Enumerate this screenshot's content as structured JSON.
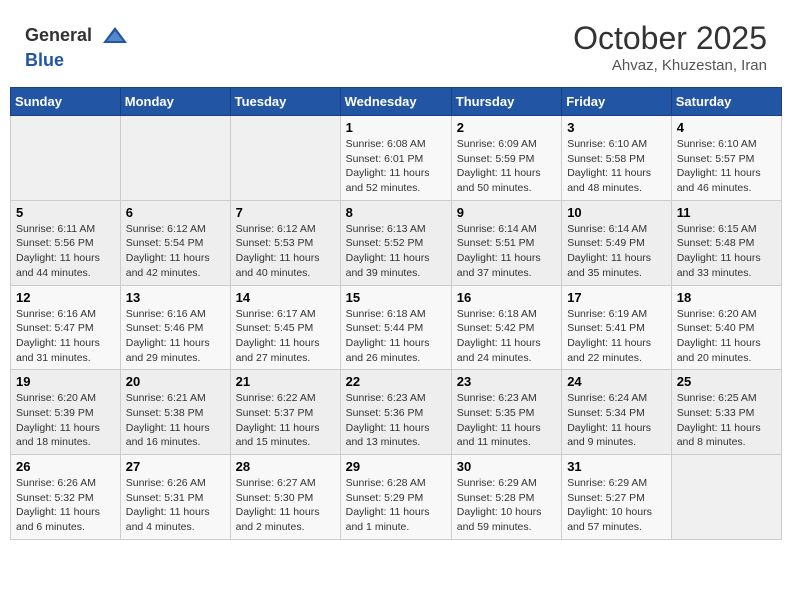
{
  "header": {
    "logo_general": "General",
    "logo_blue": "Blue",
    "month_title": "October 2025",
    "subtitle": "Ahvaz, Khuzestan, Iran"
  },
  "days_of_week": [
    "Sunday",
    "Monday",
    "Tuesday",
    "Wednesday",
    "Thursday",
    "Friday",
    "Saturday"
  ],
  "weeks": [
    [
      {
        "day": "",
        "sunrise": "",
        "sunset": "",
        "daylight": ""
      },
      {
        "day": "",
        "sunrise": "",
        "sunset": "",
        "daylight": ""
      },
      {
        "day": "",
        "sunrise": "",
        "sunset": "",
        "daylight": ""
      },
      {
        "day": "1",
        "sunrise": "Sunrise: 6:08 AM",
        "sunset": "Sunset: 6:01 PM",
        "daylight": "Daylight: 11 hours and 52 minutes."
      },
      {
        "day": "2",
        "sunrise": "Sunrise: 6:09 AM",
        "sunset": "Sunset: 5:59 PM",
        "daylight": "Daylight: 11 hours and 50 minutes."
      },
      {
        "day": "3",
        "sunrise": "Sunrise: 6:10 AM",
        "sunset": "Sunset: 5:58 PM",
        "daylight": "Daylight: 11 hours and 48 minutes."
      },
      {
        "day": "4",
        "sunrise": "Sunrise: 6:10 AM",
        "sunset": "Sunset: 5:57 PM",
        "daylight": "Daylight: 11 hours and 46 minutes."
      }
    ],
    [
      {
        "day": "5",
        "sunrise": "Sunrise: 6:11 AM",
        "sunset": "Sunset: 5:56 PM",
        "daylight": "Daylight: 11 hours and 44 minutes."
      },
      {
        "day": "6",
        "sunrise": "Sunrise: 6:12 AM",
        "sunset": "Sunset: 5:54 PM",
        "daylight": "Daylight: 11 hours and 42 minutes."
      },
      {
        "day": "7",
        "sunrise": "Sunrise: 6:12 AM",
        "sunset": "Sunset: 5:53 PM",
        "daylight": "Daylight: 11 hours and 40 minutes."
      },
      {
        "day": "8",
        "sunrise": "Sunrise: 6:13 AM",
        "sunset": "Sunset: 5:52 PM",
        "daylight": "Daylight: 11 hours and 39 minutes."
      },
      {
        "day": "9",
        "sunrise": "Sunrise: 6:14 AM",
        "sunset": "Sunset: 5:51 PM",
        "daylight": "Daylight: 11 hours and 37 minutes."
      },
      {
        "day": "10",
        "sunrise": "Sunrise: 6:14 AM",
        "sunset": "Sunset: 5:49 PM",
        "daylight": "Daylight: 11 hours and 35 minutes."
      },
      {
        "day": "11",
        "sunrise": "Sunrise: 6:15 AM",
        "sunset": "Sunset: 5:48 PM",
        "daylight": "Daylight: 11 hours and 33 minutes."
      }
    ],
    [
      {
        "day": "12",
        "sunrise": "Sunrise: 6:16 AM",
        "sunset": "Sunset: 5:47 PM",
        "daylight": "Daylight: 11 hours and 31 minutes."
      },
      {
        "day": "13",
        "sunrise": "Sunrise: 6:16 AM",
        "sunset": "Sunset: 5:46 PM",
        "daylight": "Daylight: 11 hours and 29 minutes."
      },
      {
        "day": "14",
        "sunrise": "Sunrise: 6:17 AM",
        "sunset": "Sunset: 5:45 PM",
        "daylight": "Daylight: 11 hours and 27 minutes."
      },
      {
        "day": "15",
        "sunrise": "Sunrise: 6:18 AM",
        "sunset": "Sunset: 5:44 PM",
        "daylight": "Daylight: 11 hours and 26 minutes."
      },
      {
        "day": "16",
        "sunrise": "Sunrise: 6:18 AM",
        "sunset": "Sunset: 5:42 PM",
        "daylight": "Daylight: 11 hours and 24 minutes."
      },
      {
        "day": "17",
        "sunrise": "Sunrise: 6:19 AM",
        "sunset": "Sunset: 5:41 PM",
        "daylight": "Daylight: 11 hours and 22 minutes."
      },
      {
        "day": "18",
        "sunrise": "Sunrise: 6:20 AM",
        "sunset": "Sunset: 5:40 PM",
        "daylight": "Daylight: 11 hours and 20 minutes."
      }
    ],
    [
      {
        "day": "19",
        "sunrise": "Sunrise: 6:20 AM",
        "sunset": "Sunset: 5:39 PM",
        "daylight": "Daylight: 11 hours and 18 minutes."
      },
      {
        "day": "20",
        "sunrise": "Sunrise: 6:21 AM",
        "sunset": "Sunset: 5:38 PM",
        "daylight": "Daylight: 11 hours and 16 minutes."
      },
      {
        "day": "21",
        "sunrise": "Sunrise: 6:22 AM",
        "sunset": "Sunset: 5:37 PM",
        "daylight": "Daylight: 11 hours and 15 minutes."
      },
      {
        "day": "22",
        "sunrise": "Sunrise: 6:23 AM",
        "sunset": "Sunset: 5:36 PM",
        "daylight": "Daylight: 11 hours and 13 minutes."
      },
      {
        "day": "23",
        "sunrise": "Sunrise: 6:23 AM",
        "sunset": "Sunset: 5:35 PM",
        "daylight": "Daylight: 11 hours and 11 minutes."
      },
      {
        "day": "24",
        "sunrise": "Sunrise: 6:24 AM",
        "sunset": "Sunset: 5:34 PM",
        "daylight": "Daylight: 11 hours and 9 minutes."
      },
      {
        "day": "25",
        "sunrise": "Sunrise: 6:25 AM",
        "sunset": "Sunset: 5:33 PM",
        "daylight": "Daylight: 11 hours and 8 minutes."
      }
    ],
    [
      {
        "day": "26",
        "sunrise": "Sunrise: 6:26 AM",
        "sunset": "Sunset: 5:32 PM",
        "daylight": "Daylight: 11 hours and 6 minutes."
      },
      {
        "day": "27",
        "sunrise": "Sunrise: 6:26 AM",
        "sunset": "Sunset: 5:31 PM",
        "daylight": "Daylight: 11 hours and 4 minutes."
      },
      {
        "day": "28",
        "sunrise": "Sunrise: 6:27 AM",
        "sunset": "Sunset: 5:30 PM",
        "daylight": "Daylight: 11 hours and 2 minutes."
      },
      {
        "day": "29",
        "sunrise": "Sunrise: 6:28 AM",
        "sunset": "Sunset: 5:29 PM",
        "daylight": "Daylight: 11 hours and 1 minute."
      },
      {
        "day": "30",
        "sunrise": "Sunrise: 6:29 AM",
        "sunset": "Sunset: 5:28 PM",
        "daylight": "Daylight: 10 hours and 59 minutes."
      },
      {
        "day": "31",
        "sunrise": "Sunrise: 6:29 AM",
        "sunset": "Sunset: 5:27 PM",
        "daylight": "Daylight: 10 hours and 57 minutes."
      },
      {
        "day": "",
        "sunrise": "",
        "sunset": "",
        "daylight": ""
      }
    ]
  ]
}
